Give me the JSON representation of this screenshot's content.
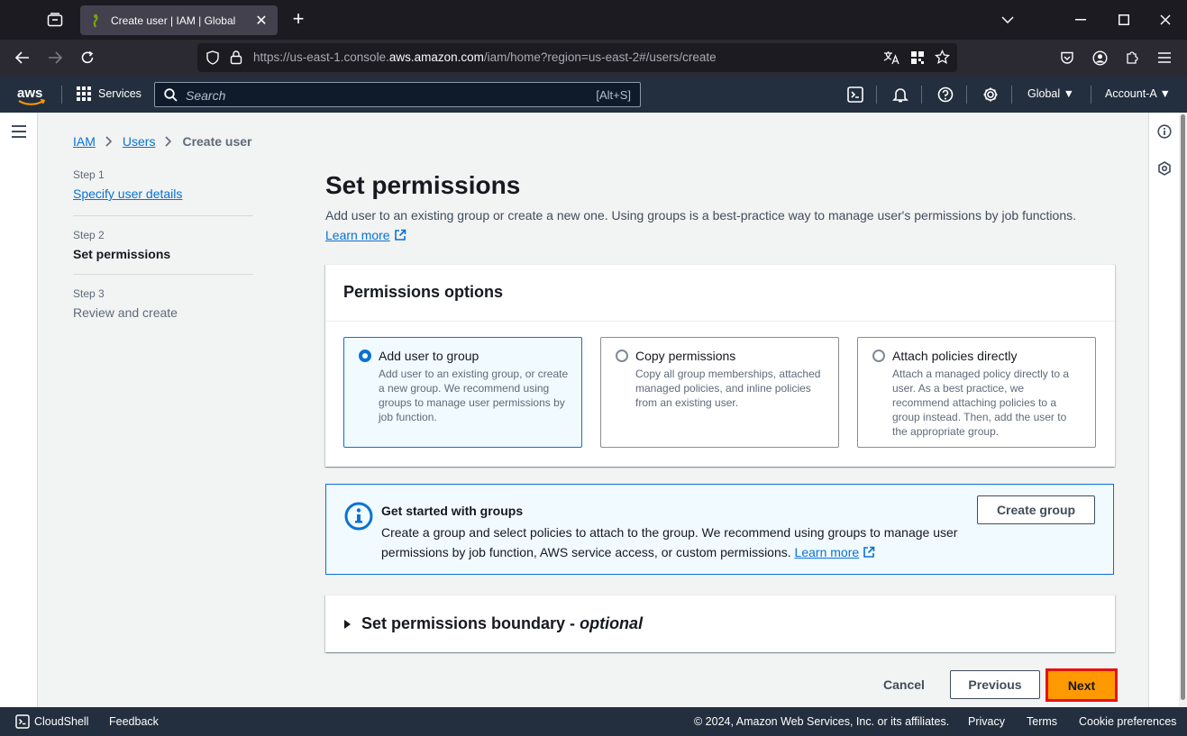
{
  "browser": {
    "tab_title": "Create user | IAM | Global",
    "url_prefix": "https://us-east-1.console.",
    "url_domain": "aws.amazon.com",
    "url_suffix": "/iam/home?region=us-east-2#/users/create"
  },
  "aws_nav": {
    "services_label": "Services",
    "search_placeholder": "Search",
    "search_shortcut": "[Alt+S]",
    "region_label": "Global",
    "account_label": "Account-A"
  },
  "breadcrumb": {
    "items": [
      "IAM",
      "Users"
    ],
    "current": "Create user"
  },
  "steps": [
    {
      "num": "Step 1",
      "label": "Specify user details"
    },
    {
      "num": "Step 2",
      "label": "Set permissions"
    },
    {
      "num": "Step 3",
      "label": "Review and create"
    }
  ],
  "page": {
    "title": "Set permissions",
    "description": "Add user to an existing group or create a new one. Using groups is a best-practice way to manage user's permissions by job functions.",
    "learn_more": "Learn more"
  },
  "permissions_options": {
    "header": "Permissions options",
    "selected": "Add user to group",
    "tiles": [
      {
        "title": "Add user to group",
        "desc": "Add user to an existing group, or create a new group. We recommend using groups to manage user permissions by job function."
      },
      {
        "title": "Copy permissions",
        "desc": "Copy all group memberships, attached managed policies, and inline policies from an existing user."
      },
      {
        "title": "Attach policies directly",
        "desc": "Attach a managed policy directly to a user. As a best practice, we recommend attaching policies to a group instead. Then, add the user to the appropriate group."
      }
    ]
  },
  "info": {
    "title": "Get started with groups",
    "body": "Create a group and select policies to attach to the group. We recommend using groups to manage user permissions by job function, AWS service access, or custom permissions.",
    "learn_more": "Learn more",
    "button": "Create group"
  },
  "boundary": {
    "label": "Set permissions boundary -",
    "optional": "optional"
  },
  "actions": {
    "cancel": "Cancel",
    "previous": "Previous",
    "next": "Next"
  },
  "footer": {
    "cloudshell": "CloudShell",
    "feedback": "Feedback",
    "copyright": "© 2024, Amazon Web Services, Inc. or its affiliates.",
    "privacy": "Privacy",
    "terms": "Terms",
    "cookies": "Cookie preferences"
  },
  "colors": {
    "accent": "#0972d3",
    "primary_button": "#ff9900",
    "highlight_border": "#e8110e",
    "nav_bg": "#232f3e"
  }
}
